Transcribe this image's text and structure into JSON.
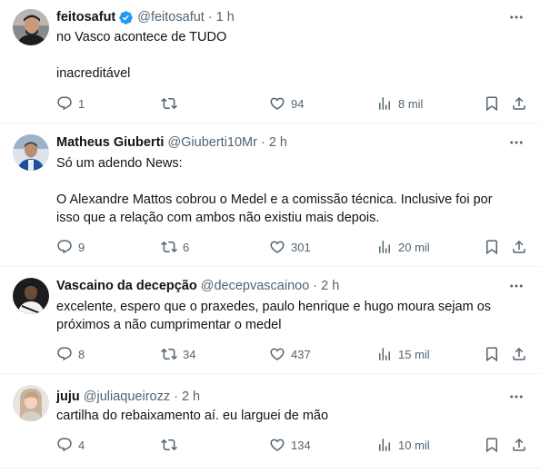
{
  "tweets": [
    {
      "name": "feitosafut",
      "verified": true,
      "handle": "@feitosafut",
      "time": "1 h",
      "lines": [
        "no Vasco acontece de TUDO",
        "",
        "inacreditável"
      ],
      "replies": "1",
      "retweets": "",
      "likes": "94",
      "views": "8 mil"
    },
    {
      "name": "Matheus Giuberti",
      "verified": false,
      "handle": "@Giuberti10Mr",
      "time": "2 h",
      "lines": [
        "Só um adendo News:",
        "",
        "O Alexandre Mattos cobrou o Medel e a comissão técnica. Inclusive foi por",
        "isso que a relação com ambos não existiu mais depois."
      ],
      "replies": "9",
      "retweets": "6",
      "likes": "301",
      "views": "20 mil"
    },
    {
      "name": "Vascaino da decepção",
      "verified": false,
      "handle": "@decepvascainoo",
      "time": "2 h",
      "lines": [
        "excelente, espero que o praxedes, paulo henrique e hugo moura sejam os",
        "próximos a não cumprimentar o medel"
      ],
      "replies": "8",
      "retweets": "34",
      "likes": "437",
      "views": "15 mil"
    },
    {
      "name": "juju",
      "verified": false,
      "handle": "@juliaqueirozz",
      "time": "2 h",
      "lines": [
        "cartilha do rebaixamento aí. eu larguei de mão"
      ],
      "replies": "4",
      "retweets": "",
      "likes": "134",
      "views": "10 mil"
    }
  ],
  "separator": "·",
  "colors": {
    "text": "#0f1419",
    "secondary": "#536471",
    "verified_blue": "#1d9bf0",
    "divider": "#eff3f4"
  },
  "icons": {
    "reply": "reply-icon",
    "retweet": "retweet-icon",
    "like": "like-icon",
    "views": "views-icon",
    "bookmark": "bookmark-icon",
    "share": "share-icon",
    "more": "more-icon",
    "verified": "verified-badge-icon"
  }
}
